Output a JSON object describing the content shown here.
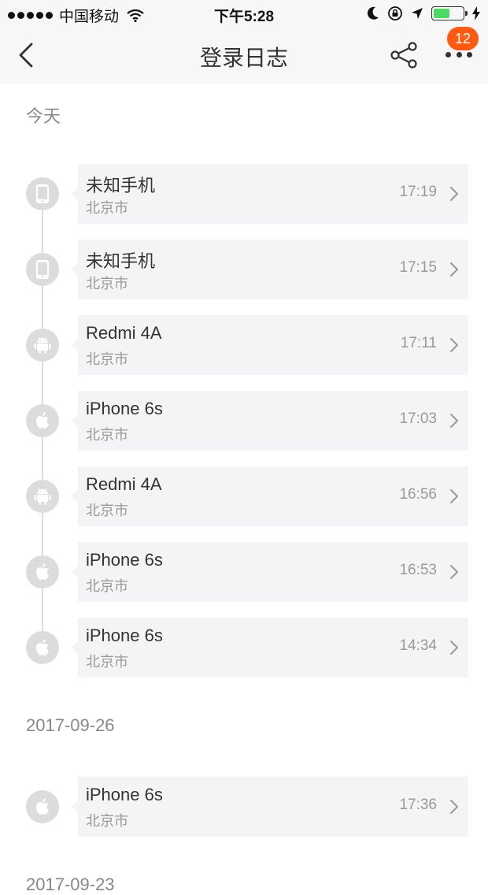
{
  "status_bar": {
    "carrier": "中国移动",
    "time": "下午5:28",
    "battery_level": 0.55,
    "icons": [
      "signal-dots-icon",
      "wifi-icon",
      "moon-icon",
      "rotation-lock-icon",
      "location-arrow-icon",
      "battery-icon",
      "charging-bolt-icon"
    ]
  },
  "nav": {
    "title": "登录日志",
    "badge_count": "12",
    "icons": [
      "back-chevron-icon",
      "share-icon",
      "more-dots-icon"
    ]
  },
  "colors": {
    "badge": "#ff5a12",
    "card_bg": "#f4f4f6",
    "dot_bg": "#dcdcdc",
    "battery_fill": "#4cd964"
  },
  "sections": [
    {
      "header": "今天",
      "entries": [
        {
          "device": "未知手机",
          "location": "北京市",
          "time": "17:19",
          "icon": "phone-icon"
        },
        {
          "device": "未知手机",
          "location": "北京市",
          "time": "17:15",
          "icon": "phone-icon"
        },
        {
          "device": "Redmi 4A",
          "location": "北京市",
          "time": "17:11",
          "icon": "android-icon"
        },
        {
          "device": "iPhone 6s",
          "location": "北京市",
          "time": "17:03",
          "icon": "apple-icon"
        },
        {
          "device": "Redmi 4A",
          "location": "北京市",
          "time": "16:56",
          "icon": "android-icon"
        },
        {
          "device": "iPhone 6s",
          "location": "北京市",
          "time": "16:53",
          "icon": "apple-icon"
        },
        {
          "device": "iPhone 6s",
          "location": "北京市",
          "time": "14:34",
          "icon": "apple-icon"
        }
      ]
    },
    {
      "header": "2017-09-26",
      "entries": [
        {
          "device": "iPhone 6s",
          "location": "北京市",
          "time": "17:36",
          "icon": "apple-icon"
        }
      ]
    },
    {
      "header": "2017-09-23",
      "entries": []
    }
  ]
}
